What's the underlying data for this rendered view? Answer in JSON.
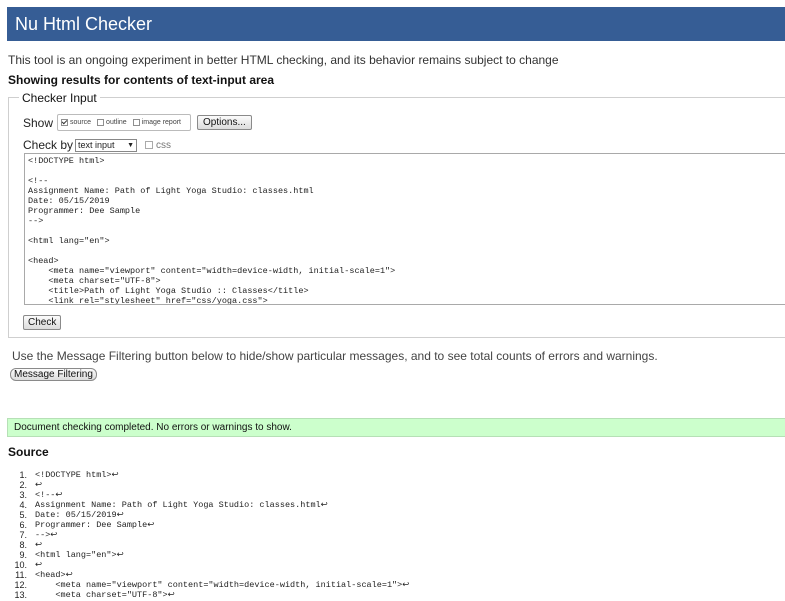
{
  "app_title": "Nu Html Checker",
  "intro_text": "This tool is an ongoing experiment in better HTML checking, and its behavior remains subject to change",
  "showing_text": "Showing results for contents of text-input area",
  "checker_input": {
    "legend": "Checker Input",
    "show_label": "Show",
    "show_options": [
      {
        "label": "source",
        "checked": true
      },
      {
        "label": "outline",
        "checked": false
      },
      {
        "label": "image report",
        "checked": false
      }
    ],
    "options_button": "Options...",
    "check_by_label": "Check by",
    "check_by_value": "text input",
    "css_label": "css",
    "check_button": "Check",
    "textarea_lines": [
      "<!DOCTYPE html>",
      "",
      "<!--",
      "Assignment Name: Path of Light Yoga Studio: classes.html",
      "Date: 05/15/2019",
      "Programmer: Dee Sample",
      "-->",
      "",
      "<html lang=\"en\">",
      "",
      "<head>",
      "    <meta name=\"viewport\" content=\"width=device-width, initial-scale=1\">",
      "    <meta charset=\"UTF-8\">",
      "    <title>Path of Light Yoga Studio :: Classes</title>",
      "    <link rel=\"stylesheet\" href=\"css/yoga.css\">"
    ]
  },
  "filter_note": "Use the Message Filtering button below to hide/show particular messages, and to see total counts of errors and warnings.",
  "filter_button": "Message Filtering",
  "status_message": "Document checking completed. No errors or warnings to show.",
  "source_heading": "Source",
  "source_lines": [
    {
      "num": "1.",
      "text": "<!DOCTYPE html>↩"
    },
    {
      "num": "2.",
      "text": "↩"
    },
    {
      "num": "3.",
      "text": "<!--↩"
    },
    {
      "num": "4.",
      "text": "Assignment Name: Path of Light Yoga Studio: classes.html↩"
    },
    {
      "num": "5.",
      "text": "Date: 05/15/2019↩"
    },
    {
      "num": "6.",
      "text": "Programmer: Dee Sample↩"
    },
    {
      "num": "7.",
      "text": "-->↩"
    },
    {
      "num": "8.",
      "text": "↩"
    },
    {
      "num": "9.",
      "text": "<html lang=\"en\">↩"
    },
    {
      "num": "10.",
      "text": "↩"
    },
    {
      "num": "11.",
      "text": "<head>↩"
    },
    {
      "num": "12.",
      "text": "    <meta name=\"viewport\" content=\"width=device-width, initial-scale=1\">↩"
    },
    {
      "num": "13.",
      "text": "    <meta charset=\"UTF-8\">↩"
    }
  ],
  "colors": {
    "header_bg": "#365d95",
    "success_bg": "#ccffcc"
  }
}
